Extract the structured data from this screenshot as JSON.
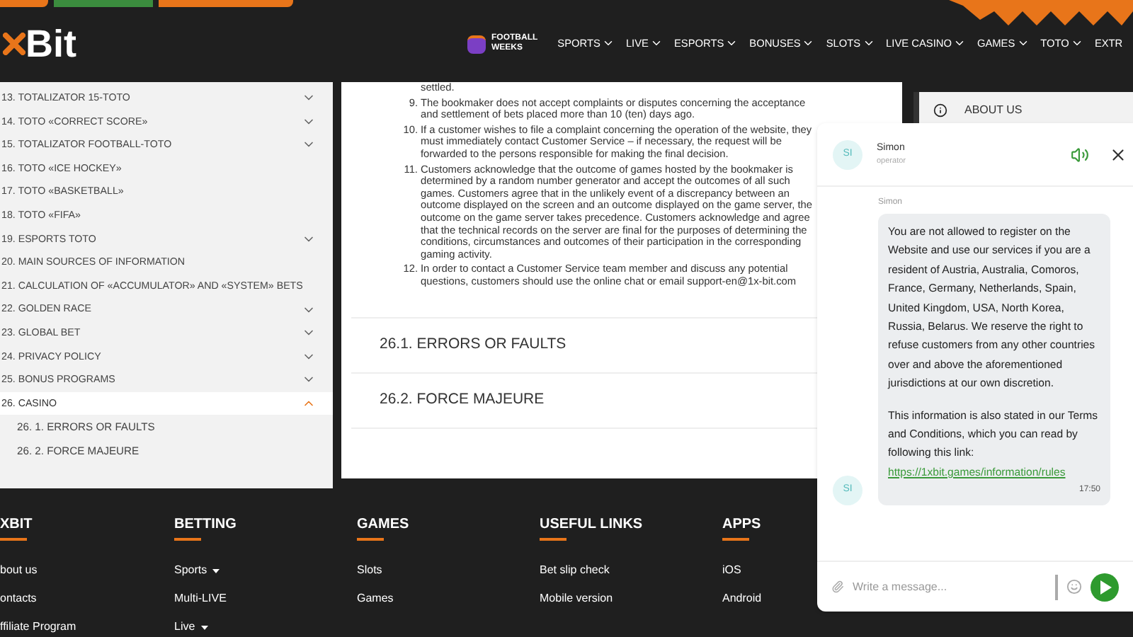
{
  "header": {
    "logo": "Bit",
    "promo": [
      "FOOTBALL",
      "WEEKS"
    ],
    "nav": [
      {
        "label": "SPORTS"
      },
      {
        "label": "LIVE"
      },
      {
        "label": "ESPORTS"
      },
      {
        "label": "BONUSES"
      },
      {
        "label": "SLOTS"
      },
      {
        "label": "LIVE CASINO"
      },
      {
        "label": "GAMES"
      },
      {
        "label": "TOTO"
      },
      {
        "label": "EXTR"
      }
    ]
  },
  "sidebar": {
    "items": [
      {
        "label": "13. TOTALIZATOR 15-TOTO",
        "chevron": true,
        "expanded": false
      },
      {
        "label": "14. TOTO «CORRECT SCORE»",
        "chevron": true,
        "expanded": false
      },
      {
        "label": "15. TOTALIZATOR FOOTBALL-TOTO",
        "chevron": true,
        "expanded": false
      },
      {
        "label": "16. TOTO «ICE HOCKEY»",
        "chevron": false,
        "expanded": false
      },
      {
        "label": "17. TOTO «BASKETBALL»",
        "chevron": false,
        "expanded": false
      },
      {
        "label": "18. TOTO «FIFA»",
        "chevron": false,
        "expanded": false
      },
      {
        "label": "19. ESPORTS TOTO",
        "chevron": true,
        "expanded": false
      },
      {
        "label": "20. MAIN SOURCES OF INFORMATION",
        "chevron": false,
        "expanded": false
      },
      {
        "label": "21. CALCULATION OF «ACCUMULATOR» AND «SYSTEM» BETS",
        "chevron": false,
        "expanded": false
      },
      {
        "label": "22. GOLDEN RACE",
        "chevron": true,
        "expanded": false
      },
      {
        "label": "23. GLOBAL BET",
        "chevron": true,
        "expanded": false
      },
      {
        "label": "24. PRIVACY POLICY",
        "chevron": true,
        "expanded": false
      },
      {
        "label": "25. BONUS PROGRAMS",
        "chevron": true,
        "expanded": false
      },
      {
        "label": "26. CASINO",
        "chevron": true,
        "expanded": true,
        "children": [
          {
            "label": "26. 1. ERRORS OR FAULTS"
          },
          {
            "label": "26. 2. FORCE MAJEURE"
          }
        ]
      }
    ]
  },
  "content": {
    "fragment": "settled.",
    "rules": [
      {
        "number": "9.",
        "text": "The bookmaker does not accept complaints or disputes concerning the acceptance and settlement of bets placed more than 10 (ten) days ago."
      },
      {
        "number": "10.",
        "text": "If a customer wishes to file a complaint concerning the operation of the website, they must immediately contact Customer Service – if necessary, the request will be forwarded to the persons responsible for making the final decision."
      },
      {
        "number": "11.",
        "text": "Customers acknowledge that the outcome of games hosted by the bookmaker is determined by a random number generator and accept the outcomes of all such games. Customers agree that in the unlikely event of a discrepancy between an outcome displayed on the screen and an outcome displayed on the game server, the outcome on the game server takes precedence. Customers acknowledge and agree that the technical records on the server are final for the purposes of determining the conditions, circumstances and outcomes of their participation in the corresponding gaming activity."
      },
      {
        "number": "12.",
        "text": "In order to contact a Customer Service team member and discuss any potential questions, customers should use the online chat or email support-en@1x-bit.com"
      }
    ],
    "sections": [
      "26.1. ERRORS OR FAULTS",
      "26.2. FORCE MAJEURE"
    ]
  },
  "right_panel": {
    "item": "ABOUT US"
  },
  "chat": {
    "agent": {
      "initials": "SI",
      "name": "Simon",
      "role": "operator"
    },
    "sound_on": true,
    "message": {
      "sender": "Simon",
      "initials": "SI",
      "paragraphs": [
        "You are not allowed to register on the Website and use our services if you are a resident of Austria, Australia, Comoros, France, Germany, Netherlands, Spain, United Kingdom, USA, North Korea, Russia, Belarus. We reserve the right to refuse customers from any other countries over and above the aforementioned jurisdictions at our own discretion.",
        "This information is also stated in our Terms and Conditions, which you can read by following this link:"
      ],
      "link": "https://1xbit.games/information/rules",
      "time": "17:50"
    },
    "input": {
      "placeholder": "Write a message..."
    }
  },
  "footer": {
    "columns": [
      {
        "title": "XBIT",
        "links": [
          {
            "label": "bout us",
            "dropdown": false
          },
          {
            "label": "ontacts",
            "dropdown": false
          },
          {
            "label": "ffiliate Program",
            "dropdown": false
          }
        ]
      },
      {
        "title": "BETTING",
        "links": [
          {
            "label": "Sports",
            "dropdown": true
          },
          {
            "label": "Multi-LIVE",
            "dropdown": false
          },
          {
            "label": "Live",
            "dropdown": true
          }
        ]
      },
      {
        "title": "GAMES",
        "links": [
          {
            "label": "Slots",
            "dropdown": false
          },
          {
            "label": "Games",
            "dropdown": false
          }
        ]
      },
      {
        "title": "USEFUL LINKS",
        "links": [
          {
            "label": "Bet slip check",
            "dropdown": false
          },
          {
            "label": "Mobile version",
            "dropdown": false
          }
        ]
      },
      {
        "title": "APPS",
        "links": [
          {
            "label": "iOS",
            "dropdown": false
          },
          {
            "label": "Android",
            "dropdown": false
          }
        ]
      }
    ]
  }
}
